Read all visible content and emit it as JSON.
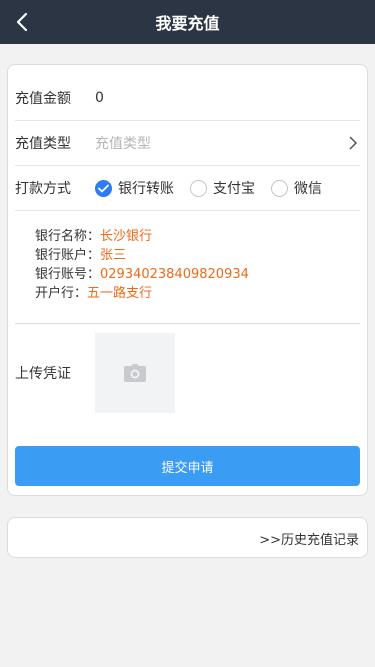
{
  "header": {
    "title": "我要充值"
  },
  "form": {
    "amount_label": "充值金额",
    "amount_value": "0",
    "type_label": "充值类型",
    "type_placeholder": "充值类型",
    "payment_label": "打款方式",
    "payment_options": [
      "银行转账",
      "支付宝",
      "微信"
    ],
    "selected_payment": "银行转账"
  },
  "bank": {
    "name_label": "银行名称：",
    "name_value": "长沙银行",
    "account_name_label": "银行账户：",
    "account_name_value": "张三",
    "account_no_label": "银行账号：",
    "account_no_value": "029340238409820934",
    "branch_label": "开户行：",
    "branch_value": "五一路支行"
  },
  "upload": {
    "label": "上传凭证"
  },
  "submit_label": "提交申请",
  "history_link": ">>历史充值记录",
  "colors": {
    "header_bg": "#2b3544",
    "accent": "#3a9df3",
    "radio_checked": "#2e7bf6",
    "bank_value": "#ef6a19"
  },
  "icons": [
    "back-arrow-icon",
    "chevron-right-icon",
    "check-icon",
    "camera-icon"
  ]
}
